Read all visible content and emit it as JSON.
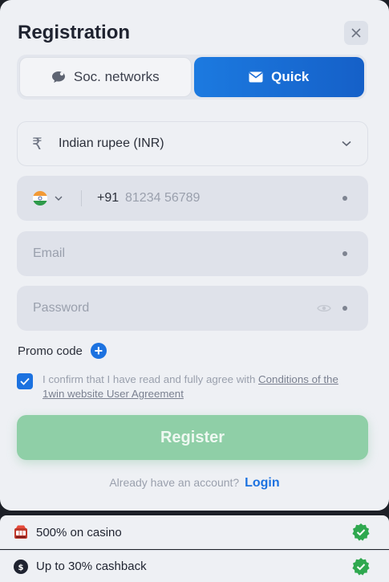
{
  "modal": {
    "title": "Registration",
    "tabs": [
      {
        "label": "Soc. networks",
        "icon": "chat-bubble-icon",
        "active": false
      },
      {
        "label": "Quick",
        "icon": "envelope-icon",
        "active": true
      }
    ]
  },
  "form": {
    "currency": {
      "value": "Indian rupee (INR)",
      "icon": "rupee-icon"
    },
    "phone": {
      "country_flag": "india-flag-icon",
      "code": "+91",
      "placeholder": "81234 56789"
    },
    "email": {
      "placeholder": "Email"
    },
    "password": {
      "placeholder": "Password"
    },
    "promo_label": "Promo code",
    "agreement": {
      "checked": true,
      "text": "I confirm that I have read and fully agree with",
      "link": "Conditions of the 1win website User Agreement"
    },
    "register_label": "Register",
    "login_prompt": "Already have an account?",
    "login_link": "Login"
  },
  "bonuses": [
    {
      "label": "500% on casino",
      "icon": "slot-machine-icon"
    },
    {
      "label": "Up to 30% cashback",
      "icon": "cashback-coin-icon"
    }
  ],
  "colors": {
    "accent": "#1c72e0",
    "register": "#8fcfa7",
    "badge": "#2fa84f"
  }
}
